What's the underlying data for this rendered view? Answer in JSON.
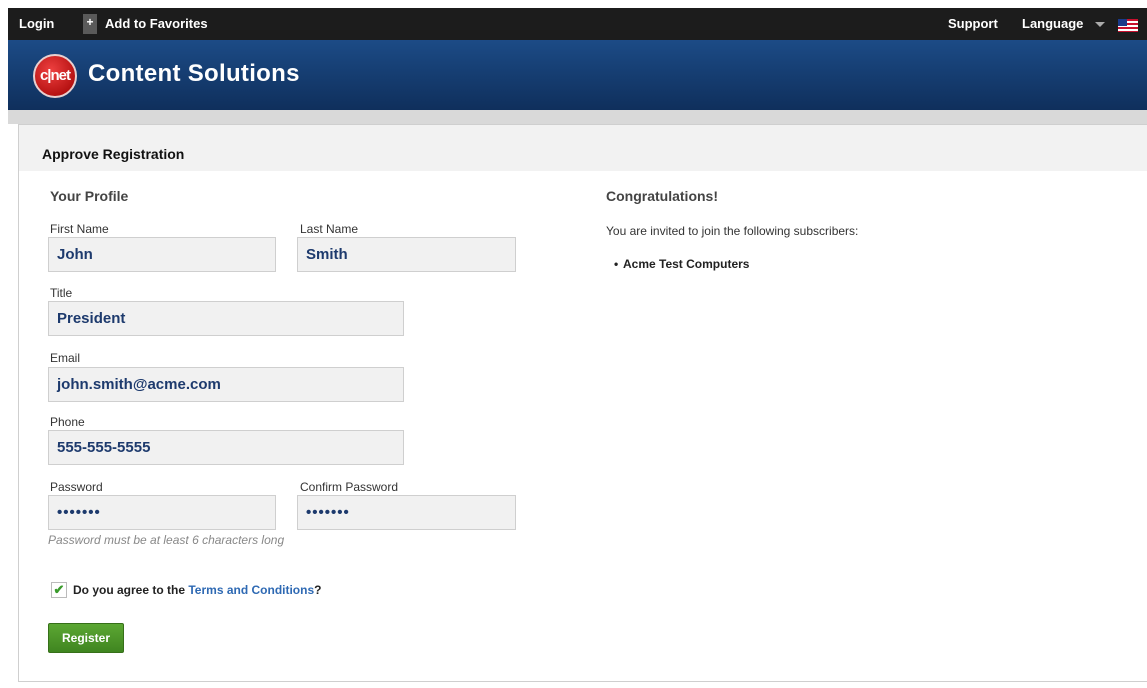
{
  "topbar": {
    "login": "Login",
    "add_favorites": "Add to Favorites",
    "support": "Support",
    "language": "Language"
  },
  "banner": {
    "logo_text": "c|net",
    "brand": "Content Solutions"
  },
  "panel": {
    "title": "Approve Registration"
  },
  "profile": {
    "heading": "Your Profile",
    "first_name_label": "First Name",
    "first_name_value": "John",
    "last_name_label": "Last Name",
    "last_name_value": "Smith",
    "title_label": "Title",
    "title_value": "President",
    "email_label": "Email",
    "email_value": "john.smith@acme.com",
    "phone_label": "Phone",
    "phone_value": "555-555-5555",
    "password_label": "Password",
    "password_value": "•••••••",
    "confirm_label": "Confirm Password",
    "confirm_value": "•••••••",
    "password_hint": "Password must be at least 6 characters long",
    "agree_prefix": "Do you agree to the",
    "terms_link": "Terms and Conditions",
    "agree_suffix": "?",
    "register_label": "Register"
  },
  "congrats": {
    "heading": "Congratulations!",
    "invite_text": "You are invited to join the following subscribers:",
    "subscribers": [
      "Acme Test Computers"
    ]
  },
  "colors": {
    "banner": "#1c4b86",
    "topbar": "#1c1c1c",
    "field_text": "#1d3a6d",
    "register_button": "#4a9428",
    "link": "#2e69b3"
  },
  "icons": {
    "plus": "plus-icon",
    "caret": "caret-down-icon",
    "flag": "us-flag-icon",
    "check": "checkmark-icon"
  }
}
